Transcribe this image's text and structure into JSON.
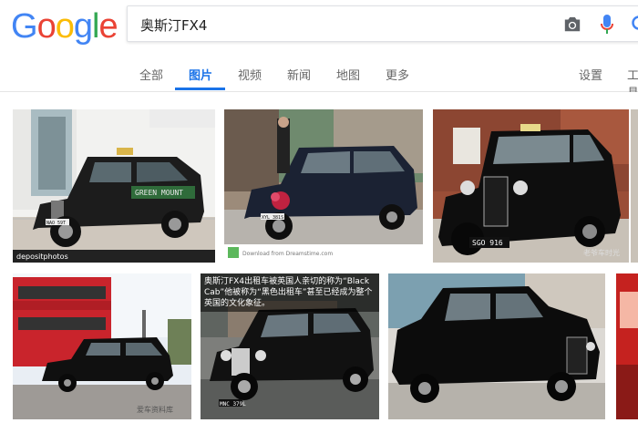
{
  "logo": {
    "letters": [
      "G",
      "o",
      "o",
      "g",
      "l",
      "e"
    ],
    "colors": [
      "#4285F4",
      "#EA4335",
      "#FBBC05",
      "#4285F4",
      "#34A853",
      "#EA4335"
    ]
  },
  "search": {
    "query": "奥斯汀FX4"
  },
  "tabs": {
    "all": "全部",
    "images": "图片",
    "videos": "视频",
    "news": "新闻",
    "maps": "地图",
    "more": "更多",
    "settings": "设置",
    "tools": "工具",
    "active": "images"
  },
  "results": [
    {
      "watermark": "depositphotos",
      "sign": "GREEN MOUNT",
      "plate": "NAO 59T"
    },
    {
      "watermark": "Download from Dreamstime.com",
      "plate": "XYL 381S"
    },
    {
      "watermark": "老爷车时光",
      "plate": "SGO 916"
    },
    {
      "watermark": "爱车资料库"
    },
    {
      "caption": "奥斯汀FX4出租车被英国人亲切的称为“Black Cab”他被称为“黑色出租车”甚至已经成为整个英国的文化象征。",
      "plate": "MNC 379L"
    },
    {
      "watermark": ""
    }
  ],
  "colors": {
    "accent": "#1a73e8",
    "tab_text": "#666666"
  }
}
